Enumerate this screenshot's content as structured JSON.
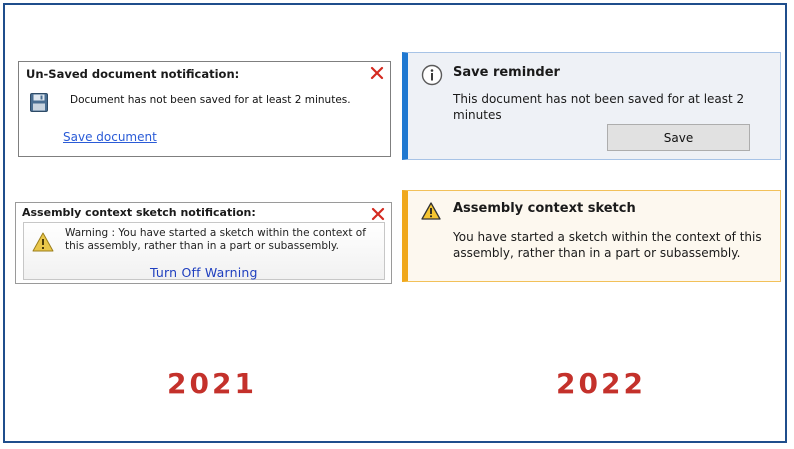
{
  "old": {
    "unsaved": {
      "title": "Un-Saved document notification:",
      "message": "Document has not been saved for at least 2 minutes.",
      "link": "Save document",
      "close_icon": "close-x-icon",
      "doc_icon": "floppy-disk-icon"
    },
    "sketch": {
      "title": "Assembly context sketch notification:",
      "message": "Warning : You have started a sketch within the context of this assembly, rather than in a part or subassembly.",
      "action": "Turn Off Warning",
      "close_icon": "close-x-icon",
      "warn_icon": "warning-triangle-icon"
    }
  },
  "new": {
    "reminder": {
      "title": "Save reminder",
      "message": "This document has not been saved for at least 2 minutes",
      "button": "Save",
      "icon": "info-icon",
      "accent": "#1f78d1"
    },
    "sketch": {
      "title": "Assembly context sketch",
      "message": "You have started a sketch within the context of this assembly, rather than in a part or subassembly.",
      "icon": "warning-triangle-icon",
      "accent": "#f0a81c"
    }
  },
  "labels": {
    "year_left": "2021",
    "year_right": "2022"
  },
  "colors": {
    "frame": "#1f4e8c",
    "year": "#c4312b",
    "close": "#d42a20",
    "link": "#2a5bd7"
  }
}
